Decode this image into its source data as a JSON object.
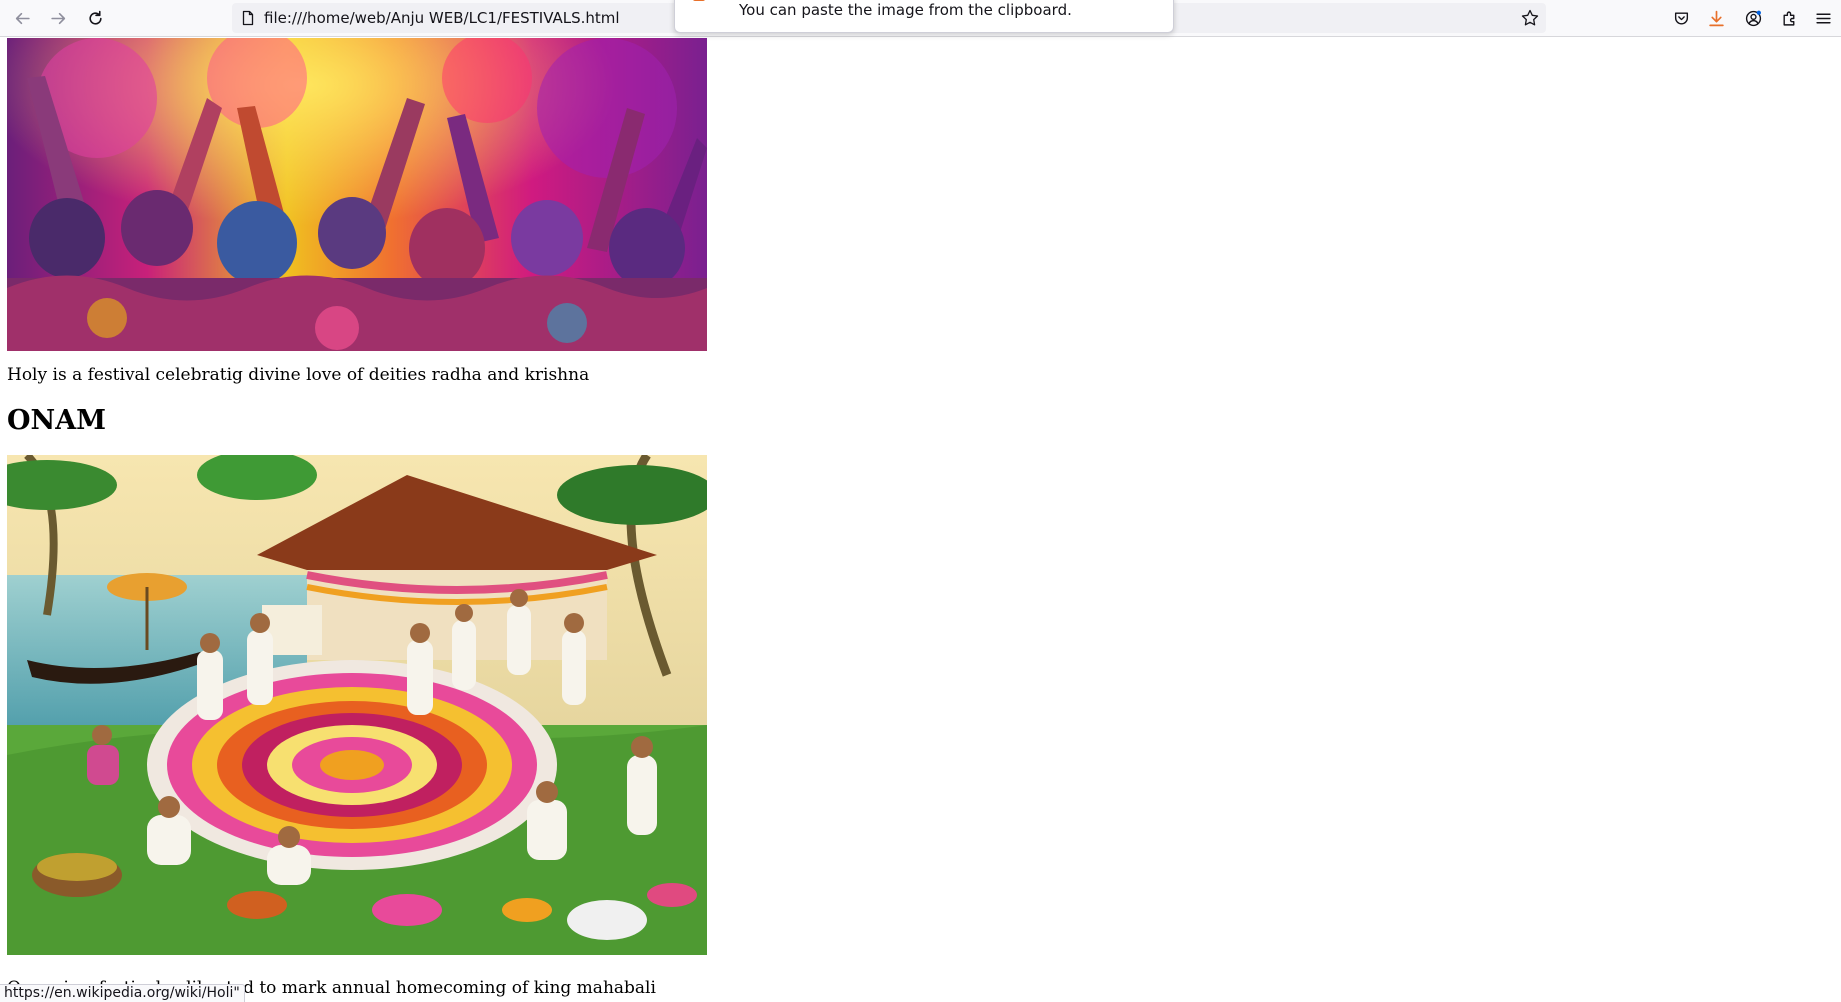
{
  "browser": {
    "url": "file:///home/web/Anju WEB/LC1/FESTIVALS.html",
    "status_url": "https://en.wikipedia.org/wiki/Holi\"",
    "notification": "You can paste the image from the clipboard.",
    "icons": [
      "back-arrow-icon",
      "forward-arrow-icon",
      "reload-icon",
      "page-icon",
      "bookmark-star-icon",
      "pocket-icon",
      "download-icon",
      "account-icon",
      "extensions-icon",
      "menu-icon"
    ]
  },
  "page": {
    "holi_caption": "Holy is a festival celebratig divine love of deities radha and krishna",
    "onam_heading": "ONAM",
    "onam_caption": "Onma is a festival celibrated to mark annual homecoming of king mahabali"
  },
  "colors": {
    "toolbar_bg": "#f9f9fb",
    "urlbar_bg": "#f0f0f4",
    "download_accent": "#e8702a"
  }
}
